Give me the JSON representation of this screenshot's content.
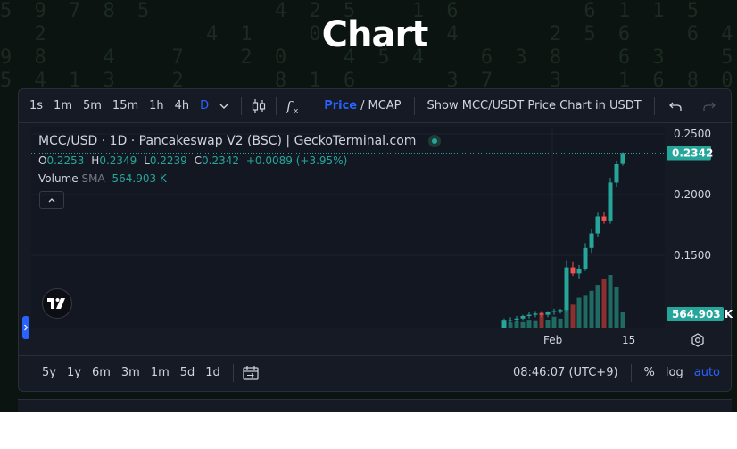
{
  "page": {
    "title": "Chart"
  },
  "toolbar": {
    "intervals": [
      "1s",
      "1m",
      "5m",
      "15m",
      "1h",
      "4h",
      "D"
    ],
    "active_interval": "D",
    "price_label": "Price",
    "slash": "/",
    "mcap_label": "MCAP",
    "show_label": "Show MCC/USDT Price Chart in USDT",
    "icons": [
      "chevron-down-icon",
      "candles-icon",
      "fx-icon",
      "undo-icon",
      "redo-icon"
    ]
  },
  "legend": {
    "title": "MCC/USD · 1D · Pancakeswap V2 (BSC) | GeckoTerminal.com",
    "o_label": "O",
    "o_val": "0.2253",
    "h_label": "H",
    "h_val": "0.2349",
    "l_label": "L",
    "l_val": "0.2239",
    "c_label": "C",
    "c_val": "0.2342",
    "change": "+0.0089 (+3.95%)",
    "volume_label": "Volume",
    "sma_label": "SMA",
    "volume_val": "564.903 K"
  },
  "price_axis": {
    "ticks": [
      "0.2500",
      "0.2000",
      "0.1500"
    ],
    "current_price_badge": "0.2342",
    "volume_badge": "564.903 K"
  },
  "time_axis": {
    "ticks": [
      "Feb",
      "15"
    ]
  },
  "bottom_bar": {
    "ranges": [
      "5y",
      "1y",
      "6m",
      "3m",
      "1m",
      "5d",
      "1d"
    ],
    "clock": "08:46:07 (UTC+9)",
    "percent_label": "%",
    "log_label": "log",
    "auto_label": "auto"
  },
  "colors": {
    "up": "#26a69a",
    "down": "#ef5350",
    "accent": "#2962ff",
    "bg": "#131722"
  },
  "chart_data": {
    "type": "candlestick",
    "ylim": [
      0.1,
      0.26
    ],
    "candles": [
      {
        "o": 0.09,
        "h": 0.098,
        "l": 0.088,
        "c": 0.096,
        "v": 90000
      },
      {
        "o": 0.096,
        "h": 0.099,
        "l": 0.094,
        "c": 0.097,
        "v": 60000
      },
      {
        "o": 0.097,
        "h": 0.1,
        "l": 0.095,
        "c": 0.098,
        "v": 70000
      },
      {
        "o": 0.098,
        "h": 0.101,
        "l": 0.096,
        "c": 0.1,
        "v": 65000
      },
      {
        "o": 0.1,
        "h": 0.103,
        "l": 0.098,
        "c": 0.101,
        "v": 80000
      },
      {
        "o": 0.101,
        "h": 0.104,
        "l": 0.099,
        "c": 0.102,
        "v": 75000
      },
      {
        "o": 0.102,
        "h": 0.104,
        "l": 0.099,
        "c": 0.101,
        "v": 160000
      },
      {
        "o": 0.101,
        "h": 0.104,
        "l": 0.099,
        "c": 0.103,
        "v": 90000
      },
      {
        "o": 0.103,
        "h": 0.106,
        "l": 0.101,
        "c": 0.104,
        "v": 120000
      },
      {
        "o": 0.104,
        "h": 0.106,
        "l": 0.102,
        "c": 0.105,
        "v": 100000
      },
      {
        "o": 0.105,
        "h": 0.146,
        "l": 0.103,
        "c": 0.14,
        "v": 520000
      },
      {
        "o": 0.14,
        "h": 0.145,
        "l": 0.133,
        "c": 0.135,
        "v": 240000
      },
      {
        "o": 0.135,
        "h": 0.142,
        "l": 0.131,
        "c": 0.139,
        "v": 310000
      },
      {
        "o": 0.139,
        "h": 0.16,
        "l": 0.137,
        "c": 0.156,
        "v": 330000
      },
      {
        "o": 0.156,
        "h": 0.172,
        "l": 0.152,
        "c": 0.168,
        "v": 380000
      },
      {
        "o": 0.168,
        "h": 0.185,
        "l": 0.165,
        "c": 0.182,
        "v": 440000
      },
      {
        "o": 0.182,
        "h": 0.186,
        "l": 0.176,
        "c": 0.178,
        "v": 500000
      },
      {
        "o": 0.178,
        "h": 0.214,
        "l": 0.176,
        "c": 0.21,
        "v": 540000
      },
      {
        "o": 0.21,
        "h": 0.228,
        "l": 0.206,
        "c": 0.225,
        "v": 420000
      },
      {
        "o": 0.2253,
        "h": 0.2349,
        "l": 0.2239,
        "c": 0.2342,
        "v": 164903
      }
    ]
  }
}
